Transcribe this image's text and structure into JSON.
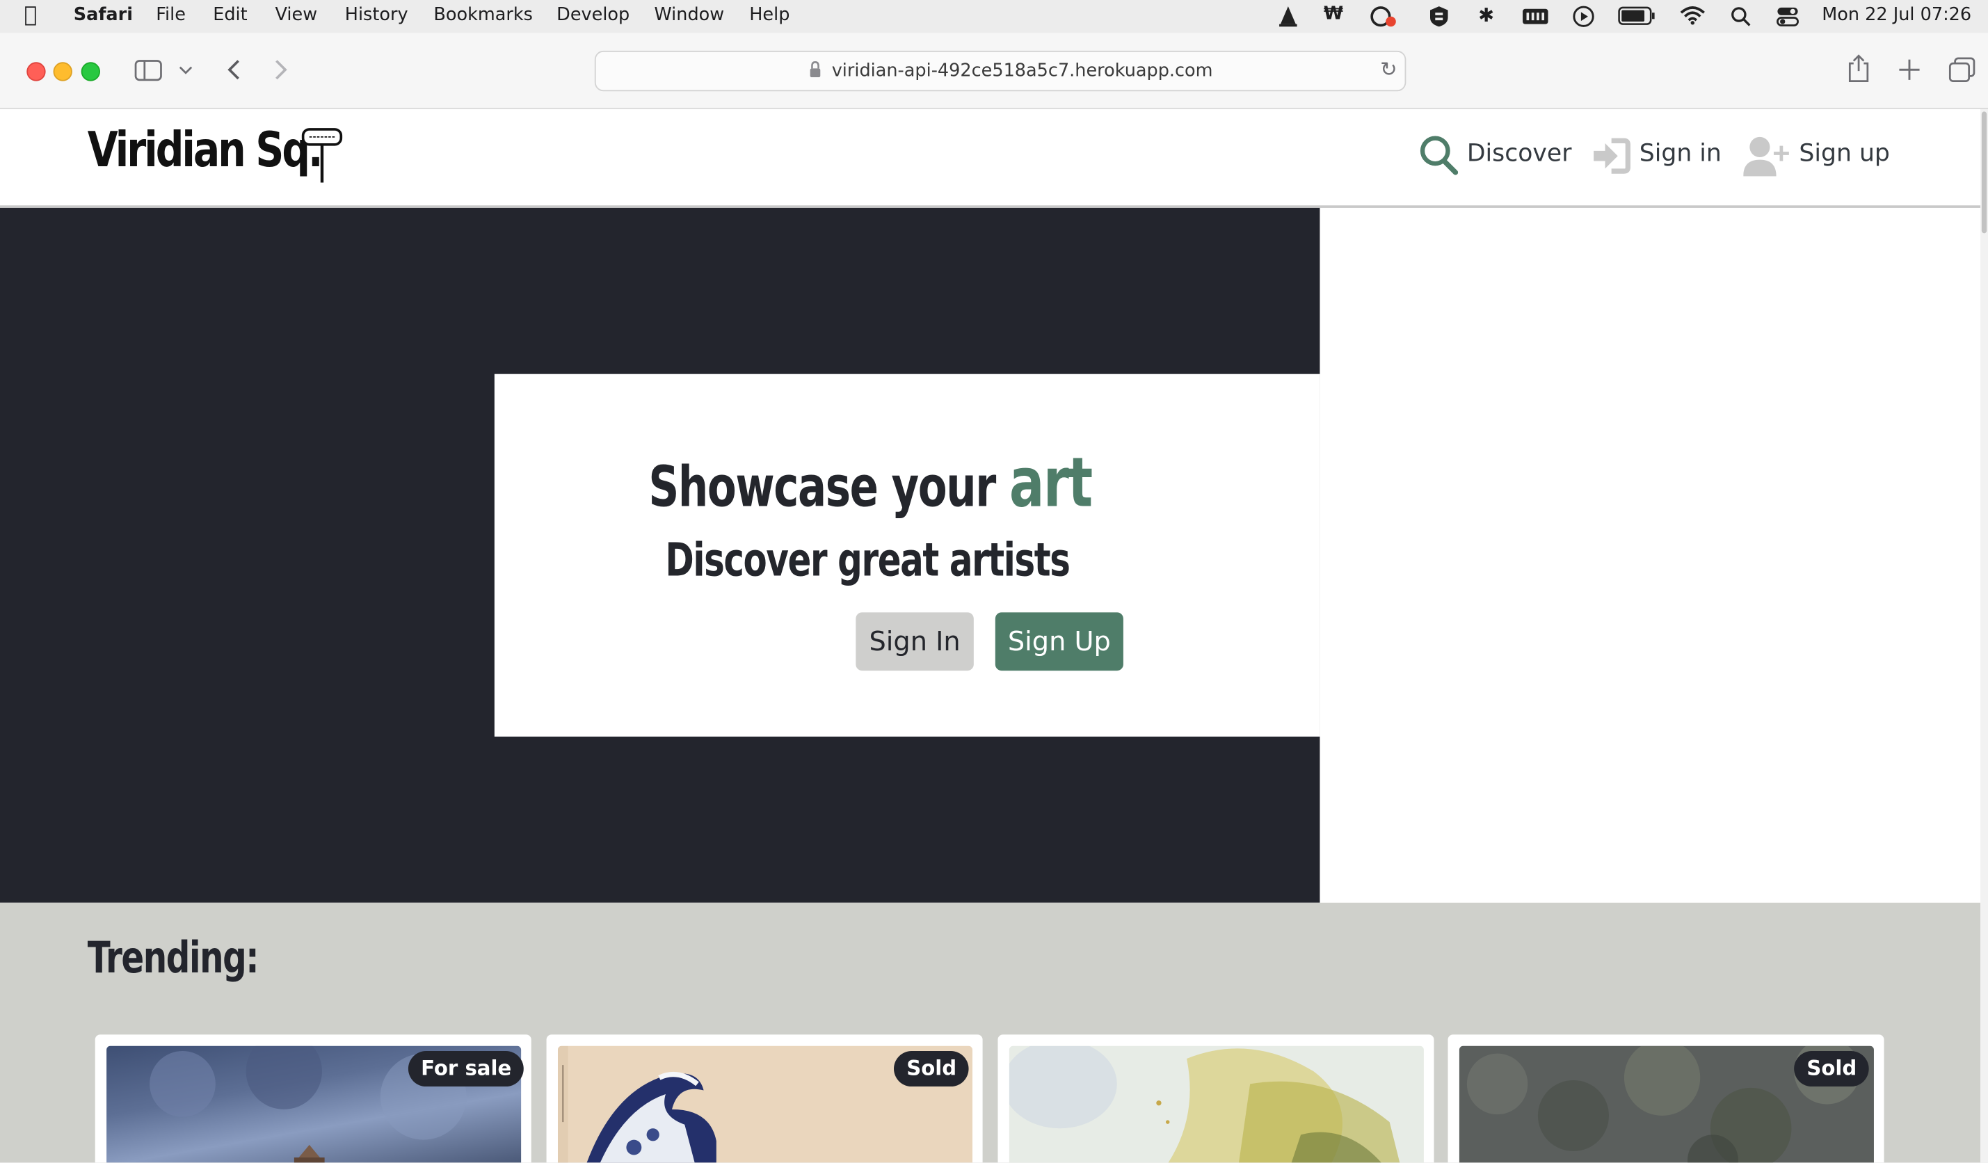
{
  "menubar": {
    "app_name": "Safari",
    "menus": [
      "File",
      "Edit",
      "View",
      "History",
      "Bookmarks",
      "Develop",
      "Window",
      "Help"
    ],
    "clock": "Mon 22 Jul  07:26"
  },
  "browser": {
    "url": "viridian-api-492ce518a5c7.herokuapp.com"
  },
  "site": {
    "brand": "Viridian Sq.",
    "nav": {
      "discover": "Discover",
      "sign_in": "Sign in",
      "sign_up": "Sign up"
    },
    "hero": {
      "line1_prefix": "Showcase your",
      "line1_accent": "art",
      "line2": "Discover great artists",
      "signin_button": "Sign In",
      "signup_button": "Sign Up"
    },
    "trending": {
      "title": "Trending:",
      "cards": [
        {
          "badge": "For sale"
        },
        {
          "badge": "Sold"
        },
        {
          "badge": ""
        },
        {
          "badge": "Sold"
        }
      ]
    }
  },
  "colors": {
    "accent": "#4f7d69",
    "dark": "#23252d",
    "trending_bg": "#cfd0cb"
  }
}
